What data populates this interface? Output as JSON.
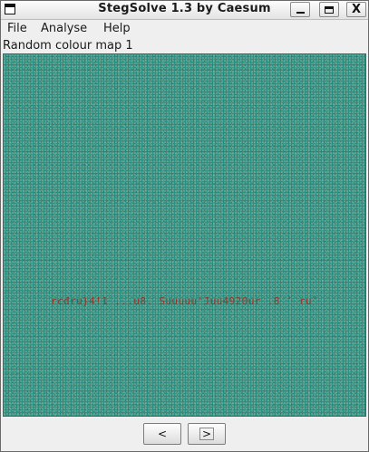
{
  "window": {
    "title": "StegSolve 1.3 by Caesum",
    "controls": {
      "minimize": "minimize",
      "maximize": "maximize",
      "close": "X"
    }
  },
  "menubar": {
    "items": [
      {
        "label": "File"
      },
      {
        "label": "Analyse"
      },
      {
        "label": "Help"
      }
    ]
  },
  "view": {
    "label": "Random colour map 1",
    "hidden_text": "rcđru}4!1   ...u8. Suuuuu'Juu4920ur .8 ʹ ruʹ"
  },
  "nav": {
    "prev_label": "<",
    "next_label": ">"
  },
  "colors": {
    "image_base": "#2a9284",
    "hidden_text": "#a02818",
    "window_bg": "#efefef"
  }
}
